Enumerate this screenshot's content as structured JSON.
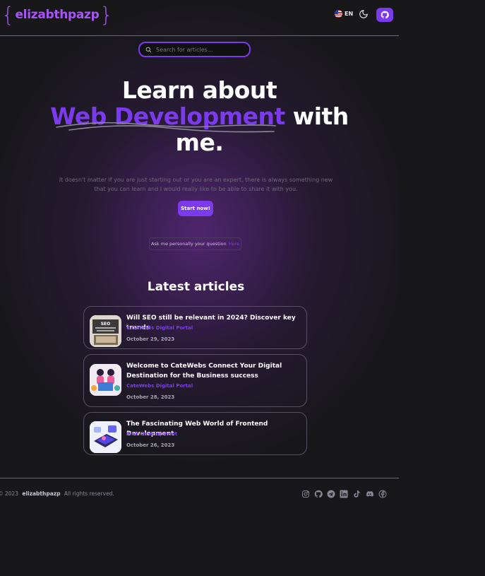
{
  "header": {
    "logo_open": "{",
    "logo_name": "elizabthpazp",
    "logo_close": "}",
    "language": "EN"
  },
  "search": {
    "placeholder": "Search for articles..."
  },
  "hero": {
    "line1": "Learn about",
    "highlight": "Web Development",
    "line2_rest": " with",
    "line3": "me.",
    "description": "It doesn't matter if you are just starting out or you are an expert, there is always something new that you can learn and I would really like to be able to share it with you.",
    "cta": "Start now!",
    "ask_text": "Ask me personally your question",
    "ask_link": "Here"
  },
  "articles": {
    "heading": "Latest articles",
    "items": [
      {
        "title": "Will SEO still be relevant in 2024? Discover key trends",
        "category": "CateWebs Digital Portal",
        "date": "October 29, 2023"
      },
      {
        "title": "Welcome to CateWebs Connect Your Digital Destination for the Business success",
        "category": "CateWebs Digital Portal",
        "date": "October 28, 2023"
      },
      {
        "title": "The Fascinating Web World of Frontend Development",
        "category": "Web Development",
        "date": "October 26, 2023"
      }
    ]
  },
  "thumb_text": {
    "seo": "SEO"
  },
  "footer": {
    "year": "© 2023",
    "brand": "elizabthpazp",
    "rights": "All rights reserved.",
    "socials": [
      "instagram-icon",
      "github-icon",
      "telegram-icon",
      "linkedin-icon",
      "tiktok-icon",
      "discord-icon",
      "facebook-icon"
    ]
  },
  "colors": {
    "accent": "#7c3aed",
    "logo": "#a855f7",
    "background": "#18181b"
  }
}
